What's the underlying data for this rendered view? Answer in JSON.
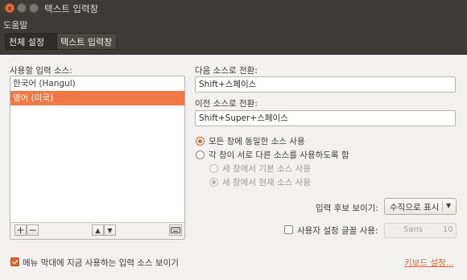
{
  "window": {
    "title": "텍스트 입력창"
  },
  "menubar": {
    "help": "도움말"
  },
  "tabs": [
    {
      "label": "전체 설정(A)"
    },
    {
      "label": "텍스트 입력창"
    }
  ],
  "sources": {
    "label": "사용할 입력 소스:",
    "items": [
      {
        "label": "한국어 (Hangul)",
        "selected": false
      },
      {
        "label": "영어 (미국)",
        "selected": true
      }
    ],
    "toolbar": {
      "add": "+",
      "remove": "−",
      "up": "▲",
      "down": "▼",
      "keyboard_icon": "keyboard-icon"
    }
  },
  "shortcuts": {
    "next_label": "다음 소스로 전환:",
    "next_value": "Shift+스페이스",
    "prev_label": "이전 소스로 전환:",
    "prev_value": "Shift+Super+스페이스"
  },
  "scope": {
    "same_all": "모든 창에 동일한 소스 사용",
    "per_window": "각 창이 서로 다른 소스를 사용하도록 함",
    "new_default": "새 창에서 기본 소스 사용",
    "new_current": "새 창에서 현재 소스 사용",
    "selected": "same_all"
  },
  "candidates": {
    "label": "입력 후보 보이기:",
    "value": "수직으로 표시"
  },
  "custom_font": {
    "label": "사용자 설정 글꼴 사용:",
    "checked": false,
    "font_name": "Sans",
    "font_size": "10"
  },
  "footer": {
    "menu_indicator": "메뉴 막대에 지금 사용하는 입력 소스 보이기",
    "menu_indicator_checked": true,
    "keyboard_settings": "키보드 설정..."
  },
  "colors": {
    "accent": "#e0652d",
    "selection": "#f07746",
    "titlebar": "#3c3b37"
  }
}
